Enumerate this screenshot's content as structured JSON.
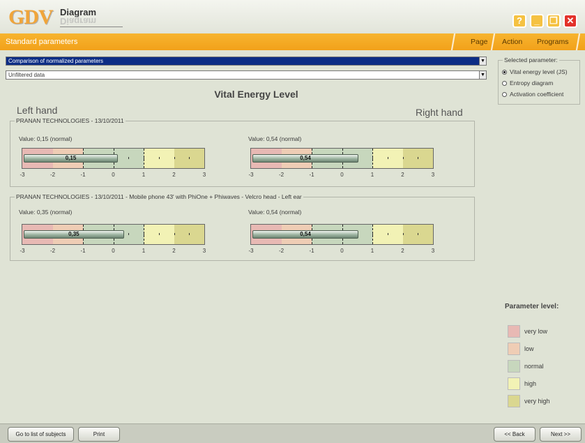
{
  "app": {
    "logo_text": "GDV",
    "logo_sub": "Diagram",
    "window_buttons": [
      "help-icon",
      "minimize-icon",
      "maximize-icon",
      "close-icon"
    ]
  },
  "menubar": {
    "section": "Standard parameters",
    "items": [
      "Page",
      "Action",
      "Programs"
    ]
  },
  "selectors": {
    "comparison": "Comparison of normalized parameters",
    "filter": "Unfiltered data"
  },
  "selected_parameter": {
    "title": "Selected parameter:",
    "options": [
      {
        "label": "Vital energy level (JS)",
        "selected": true
      },
      {
        "label": "Entropy diagram",
        "selected": false
      },
      {
        "label": "Activation coefficient",
        "selected": false
      }
    ]
  },
  "main": {
    "title": "Vital Energy Level",
    "left_hand": "Left hand",
    "right_hand": "Right hand"
  },
  "scale": {
    "min": -3,
    "max": 3,
    "ticks": [
      "-3",
      "-2",
      "-1",
      "0",
      "1",
      "2",
      "3"
    ]
  },
  "groups": [
    {
      "title": "PRANAN TECHNOLOGIES - 13/10/2011",
      "left": {
        "label": "Value: 0,15 (normal)",
        "value": 0.15,
        "value_text": "0,15"
      },
      "right": {
        "label": "Value: 0,54 (normal)",
        "value": 0.54,
        "value_text": "0,54"
      }
    },
    {
      "title": "PRANAN TECHNOLOGIES - 13/10/2011 - Mobile phone 43' with PhiOne + Phiwaves - Velcro head - Left ear",
      "left": {
        "label": "Value: 0,35 (normal)",
        "value": 0.35,
        "value_text": "0,35"
      },
      "right": {
        "label": "Value: 0,54 (normal)",
        "value": 0.54,
        "value_text": "0,54"
      }
    }
  ],
  "legend": {
    "title": "Parameter level:",
    "items": [
      {
        "label": "very low",
        "color": "#e8b9b4"
      },
      {
        "label": "low",
        "color": "#efcdb5"
      },
      {
        "label": "normal",
        "color": "#c7d7bd"
      },
      {
        "label": "high",
        "color": "#f2f2b5"
      },
      {
        "label": "very high",
        "color": "#dad790"
      }
    ]
  },
  "bottom": {
    "subjects": "Go to list of subjects",
    "print": "Print",
    "back": "<< Back",
    "next": "Next >>"
  }
}
